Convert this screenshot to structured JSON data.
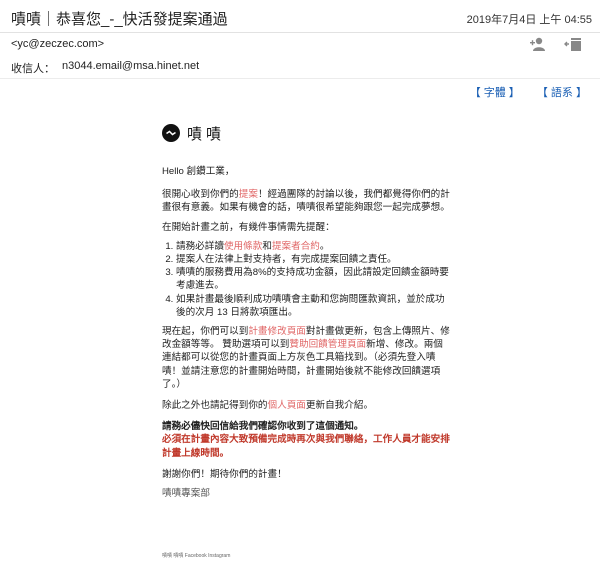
{
  "header": {
    "subject": "嘖嘖｜恭喜您_-_快活發提案通過",
    "date": "2019年7月4日 上午 04:55"
  },
  "from": "<yc@zeczec.com>",
  "to": {
    "label": "收信人：",
    "value": "n3044.email@msa.hinet.net"
  },
  "toolbar": {
    "font_link": "【 字體 】",
    "lang_link": "【 語系 】"
  },
  "brand": {
    "name": "嘖嘖"
  },
  "email": {
    "greeting": "Hello 創鑽工業，",
    "p1a": "很開心收到你們的",
    "p1_link": "提案",
    "p1b": "！經過團隊的討論以後，我們都覺得你們的計畫很有意義。如果有機會的話，嘖嘖很希望能夠跟您一起完成夢想。",
    "p2": "在開始計畫之前，有幾件事情需先提醒：",
    "list1a": "請務必詳讀",
    "list1_link1": "使用條款",
    "list1b": "和",
    "list1_link2": "提案者合約",
    "list1c": "。",
    "list2": "提案人在法律上對支持者，有完成提案回饋之責任。",
    "list3": "嘖嘖的服務費用為8%的支持成功金額，因此請設定回饋金額時要考慮進去。",
    "list4": "如果計畫最後順利成功嘖嘖會主動和您詢問匯款資訊，並於成功後的次月 13 日將款項匯出。",
    "p3a": "現在起，你們可以到",
    "p3_link1": "計畫修改頁面",
    "p3b": "對計畫做更新，包含上傳照片、修改金額等等。 贊助選項可以到",
    "p3_link2": "贊助回饋管理頁面",
    "p3c": "新增、修改。兩個連結都可以從您的計畫頁面上方灰色工具箱找到。（必須先登入嘖嘖！並請注意您的計畫開始時間，計畫開始後就不能修改回饋選項了。）",
    "p4a": "除此之外也請記得到你的",
    "p4_link": "個人頁面",
    "p4b": "更新自我介紹。",
    "bold1": "請務必儘快回信給我們確認你收到了這個通知。",
    "bold2": "必須在計畫內容大致預備完成時再次與我們聯絡，工作人員才能安排計畫上線時間。",
    "thanks": "謝謝你們！期待你們的計畫！",
    "sign": "嘖嘖專案部"
  },
  "footer": {
    "text": "嘖嘖 嘖嘖 Facebook Instagram"
  }
}
